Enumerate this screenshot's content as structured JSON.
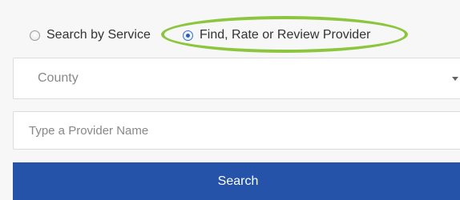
{
  "search_mode": {
    "options": [
      {
        "label": "Search by Service",
        "checked": false
      },
      {
        "label": "Find, Rate or Review Provider",
        "checked": true
      }
    ],
    "highlight_color": "#8cc63f"
  },
  "county_select": {
    "selected": "County",
    "icon": "chevron-down-icon"
  },
  "provider_input": {
    "value": "",
    "placeholder": "Type a Provider Name"
  },
  "search_button": {
    "label": "Search",
    "color": "#2553aa"
  }
}
